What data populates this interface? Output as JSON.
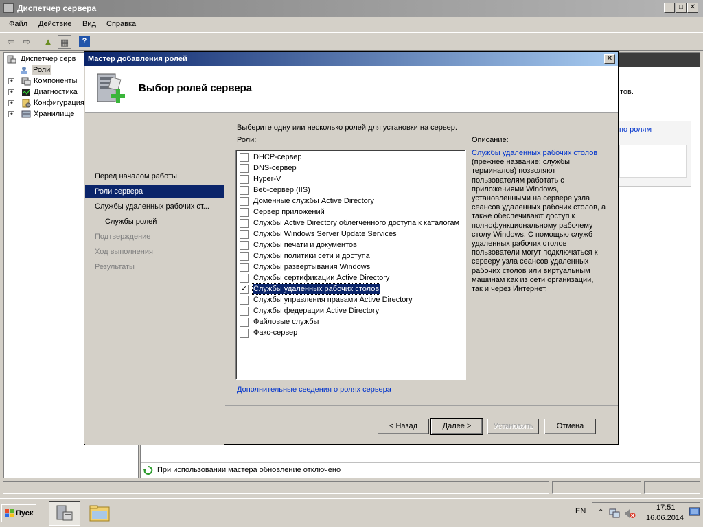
{
  "main_window": {
    "title": "Диспетчер сервера",
    "menu": [
      "Файл",
      "Действие",
      "Вид",
      "Справка"
    ],
    "tree": [
      {
        "label": "Диспетчер серв"
      },
      {
        "label": "Роли"
      },
      {
        "label": "Компоненты"
      },
      {
        "label": "Диагностика"
      },
      {
        "label": "Конфигурация"
      },
      {
        "label": "Хранилище"
      }
    ],
    "content_fragments": {
      "text1": "тов.",
      "link1": "по ролям"
    },
    "status_text": "При использовании мастера обновление отключено"
  },
  "dialog": {
    "title": "Мастер добавления ролей",
    "heading": "Выбор ролей сервера",
    "close_glyph": "✕",
    "nav": [
      {
        "label": "Перед началом работы",
        "state": "normal"
      },
      {
        "label": "Роли сервера",
        "state": "active"
      },
      {
        "label": "Службы удаленных рабочих ст...",
        "state": "normal"
      },
      {
        "label": "Службы ролей",
        "state": "normal"
      },
      {
        "label": "Подтверждение",
        "state": "disabled"
      },
      {
        "label": "Ход выполнения",
        "state": "disabled"
      },
      {
        "label": "Результаты",
        "state": "disabled"
      }
    ],
    "instruction": "Выберите одну или несколько ролей для установки на сервер.",
    "roles_label": "Роли:",
    "roles": [
      {
        "label": "DHCP-сервер",
        "checked": false
      },
      {
        "label": "DNS-сервер",
        "checked": false
      },
      {
        "label": "Hyper-V",
        "checked": false
      },
      {
        "label": "Веб-сервер (IIS)",
        "checked": false
      },
      {
        "label": "Доменные службы Active Directory",
        "checked": false
      },
      {
        "label": "Сервер приложений",
        "checked": false
      },
      {
        "label": "Службы Active Directory облегченного доступа к каталогам",
        "checked": false
      },
      {
        "label": "Службы Windows Server Update Services",
        "checked": false
      },
      {
        "label": "Службы печати и документов",
        "checked": false
      },
      {
        "label": "Службы политики сети и доступа",
        "checked": false
      },
      {
        "label": "Службы развертывания Windows",
        "checked": false
      },
      {
        "label": "Службы сертификации Active Directory",
        "checked": false
      },
      {
        "label": "Службы удаленных рабочих столов",
        "checked": true
      },
      {
        "label": "Службы управления правами Active Directory",
        "checked": false
      },
      {
        "label": "Службы федерации Active Directory",
        "checked": false
      },
      {
        "label": "Файловые службы",
        "checked": false
      },
      {
        "label": "Факс-сервер",
        "checked": false
      }
    ],
    "description_label": "Описание:",
    "description_link": "Службы удаленных рабочих столов",
    "description_text": "(прежнее название: службы терминалов) позволяют пользователям работать с приложениями Windows, установленными на сервере узла сеансов удаленных рабочих столов, а также обеспечивают доступ к полнофункциональному рабочему столу Windows. С помощью служб удаленных рабочих столов пользователи могут подключаться к серверу узла сеансов удаленных рабочих столов или виртуальным машинам как из сети организации, так и через Интернет.",
    "more_info_link": "Дополнительные сведения о ролях сервера",
    "buttons": {
      "back": "< Назад",
      "next": "Далее >",
      "install": "Установить",
      "cancel": "Отмена"
    }
  },
  "taskbar": {
    "start_label": "Пуск",
    "lang": "EN",
    "time": "17:51",
    "date": "16.06.2014"
  }
}
